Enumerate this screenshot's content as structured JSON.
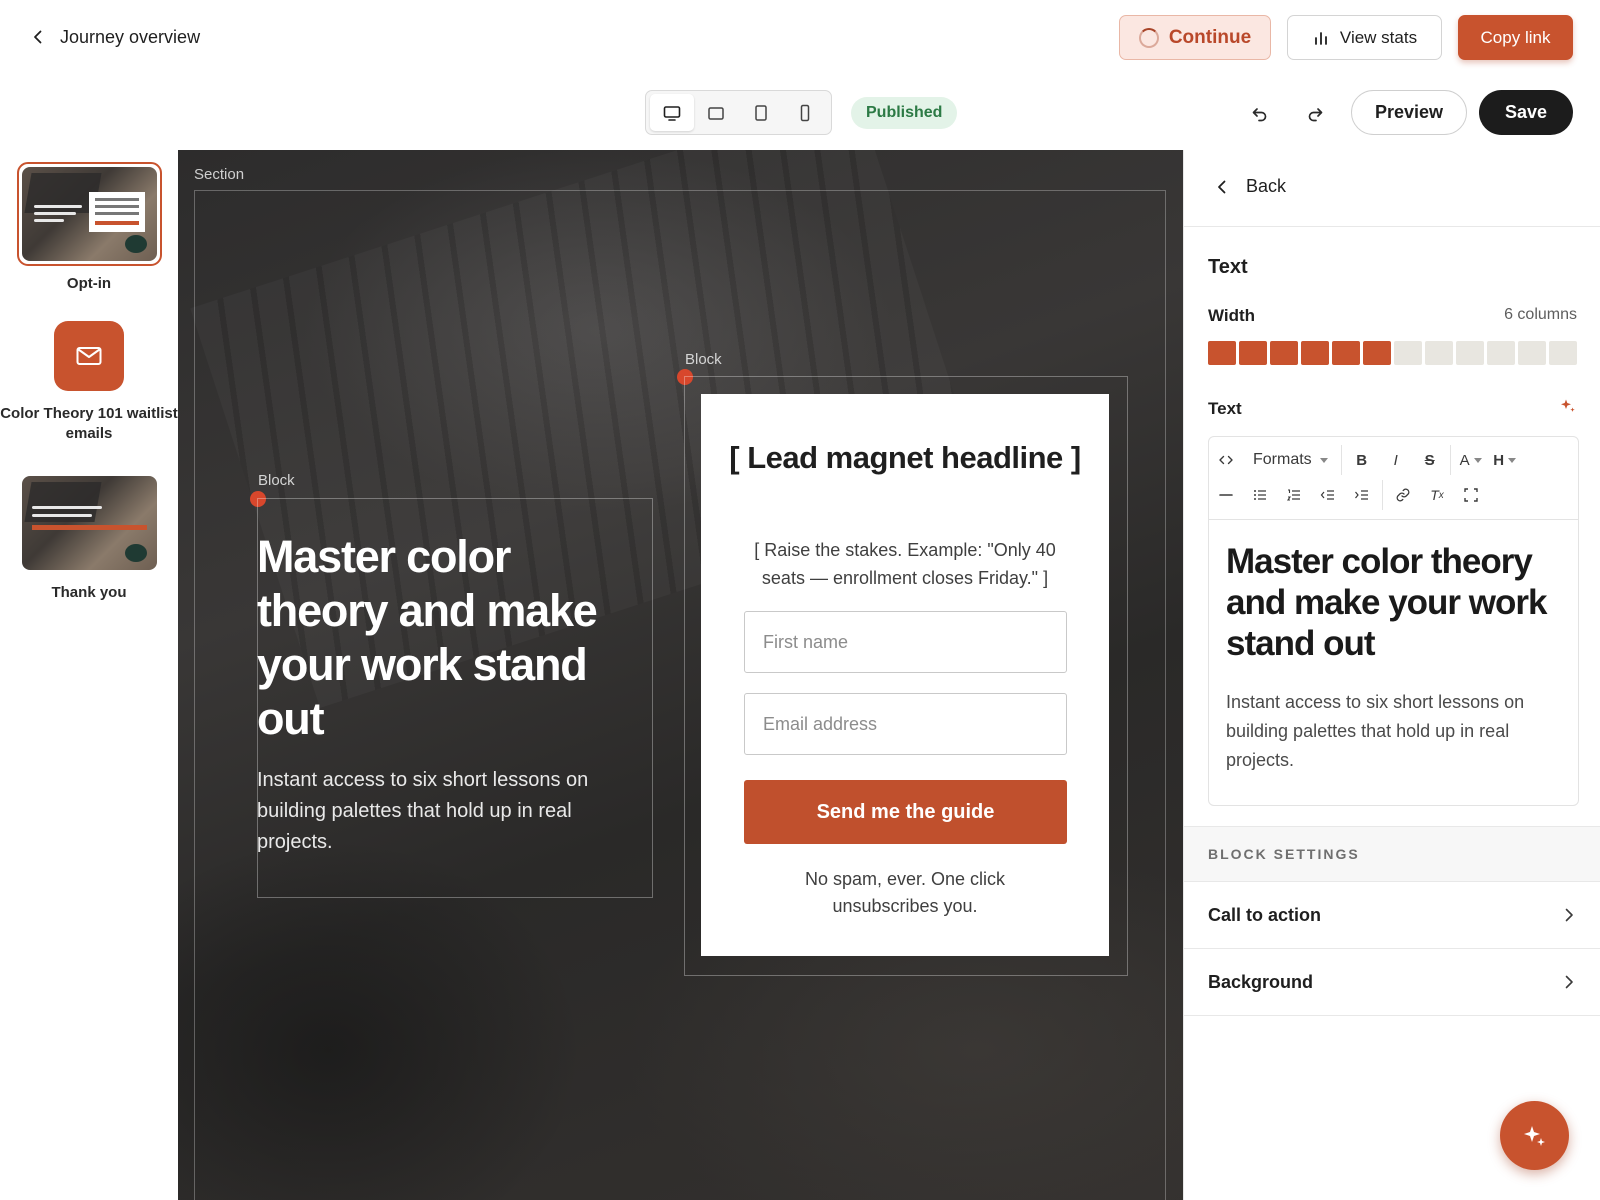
{
  "header": {
    "back_label": "Journey overview",
    "continue_label": "Continue",
    "view_stats_label": "View stats",
    "copy_link_label": "Copy link"
  },
  "toolbar": {
    "devices": [
      "desktop",
      "tablet-landscape",
      "tablet-portrait",
      "mobile"
    ],
    "active_device": "desktop",
    "status": "Published",
    "preview_label": "Preview",
    "save_label": "Save"
  },
  "steps": [
    {
      "label": "Opt-in",
      "selected": true
    },
    {
      "label": "Color Theory 101 waitlist emails",
      "icon": "mail-icon"
    },
    {
      "label": "Thank you"
    }
  ],
  "canvas": {
    "section_label": "Section",
    "block_label": "Block",
    "hero_title": "Master color theory and make your work stand out",
    "hero_sub": "Instant access to six short lessons on building palettes that hold up in real projects.",
    "form": {
      "title": "[ Lead magnet headline ]",
      "subtitle": "[ Raise the stakes. Example: \"Only 40 seats — enrollment closes Friday.\" ]",
      "first_name_placeholder": "First name",
      "email_placeholder": "Email address",
      "submit_label": "Send me the guide",
      "note": "No spam, ever. One click unsubscribes you."
    }
  },
  "panel": {
    "back_label": "Back",
    "heading": "Text",
    "width_label": "Width",
    "width_value": "6 columns",
    "width_selected": 6,
    "width_total": 12,
    "text_label": "Text",
    "formats_label": "Formats",
    "editor_title": "Master color theory and make your work stand out",
    "editor_body": "Instant access to six short lessons on building palettes that hold up in real projects.",
    "block_settings_label": "BLOCK SETTINGS",
    "settings": [
      "Call to action",
      "Background"
    ]
  },
  "colors": {
    "accent": "#c8532e",
    "published_bg": "#e3f3e8",
    "published_text": "#2c7a45"
  }
}
